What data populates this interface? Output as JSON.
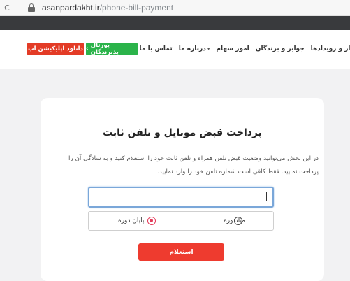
{
  "browser": {
    "nav_glyph": "C",
    "url_domain": "asanpardakht.ir",
    "url_path": "/phone-bill-payment"
  },
  "header": {
    "app_button_label": "دانلود اپلیکیشن آپ",
    "portal_button_label": "پورتال پذیرندگان",
    "nav_items": [
      {
        "label": "ار و رویدادها",
        "has_caret": true
      },
      {
        "label": "جوایز و برندگان",
        "has_caret": false
      },
      {
        "label": "امور سهام",
        "has_caret": false
      },
      {
        "label": "درباره ما",
        "has_caret": true
      },
      {
        "label": "تماس با ما",
        "has_caret": false
      }
    ]
  },
  "form": {
    "title": "پرداخت قبض موبایل و تلفن ثابت",
    "description": "در این بخش می‌توانید وضعیت قبض تلفن همراه و تلفن ثابت خود را استعلام کنید و به سادگی آن را پرداخت نمایید. فقط کافی است شماره تلفن خود را وارد نمایید.",
    "phone_value": "",
    "radio_options": [
      {
        "label": "میاندوره",
        "selected": false
      },
      {
        "label": "پایان دوره",
        "selected": true
      }
    ],
    "submit_label": "استعلام"
  },
  "colors": {
    "accent_red": "#ee3b2f",
    "green": "#2bb34a",
    "radio_selected": "#e33b5a"
  }
}
